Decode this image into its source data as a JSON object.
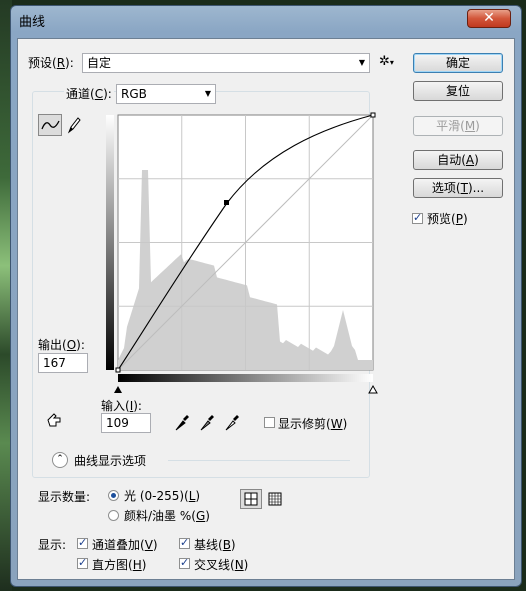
{
  "window": {
    "title": "曲线",
    "close": "✕"
  },
  "preset": {
    "label": "预设(",
    "key": "R",
    "tail": "):",
    "value": "自定"
  },
  "channel": {
    "label": "通道(",
    "key": "C",
    "tail": "):",
    "value": "RGB"
  },
  "buttons": {
    "ok": "确定",
    "reset": "复位",
    "smooth": {
      "pre": "平滑(",
      "key": "M",
      "post": ")"
    },
    "auto": {
      "pre": "自动(",
      "key": "A",
      "post": ")"
    },
    "options": {
      "pre": "选项(",
      "key": "T",
      "post": ")..."
    }
  },
  "preview": {
    "pre": "预览(",
    "key": "P",
    "post": ")",
    "checked": true
  },
  "output": {
    "pre": "输出(",
    "key": "O",
    "post": "):",
    "value": "167"
  },
  "input": {
    "pre": "输入(",
    "key": "I",
    "post": "):",
    "value": "109"
  },
  "show_clipping": {
    "pre": "显示修剪(",
    "key": "W",
    "post": ")",
    "checked": false
  },
  "curve_display_options": "曲线显示选项",
  "show_amount": {
    "label": "显示数量:",
    "light": {
      "pre": "光 (0-255)(",
      "key": "L",
      "post": ")",
      "selected": true
    },
    "pigment": {
      "pre": "颜料/油墨 %(",
      "key": "G",
      "post": ")",
      "selected": false
    }
  },
  "show": {
    "label": "显示:",
    "channel_overlays": {
      "pre": "通道叠加(",
      "key": "V",
      "post": ")",
      "checked": true
    },
    "baseline": {
      "pre": "基线(",
      "key": "B",
      "post": ")",
      "checked": true
    },
    "histogram": {
      "pre": "直方图(",
      "key": "H",
      "post": ")",
      "checked": true
    },
    "intersection_line": {
      "pre": "交叉线(",
      "key": "N",
      "post": ")",
      "checked": true
    }
  },
  "icons": [
    "gear-icon",
    "curve-tool-icon",
    "pencil-icon",
    "hand-adjust-icon",
    "black-eyedropper-icon",
    "gray-eyedropper-icon",
    "white-eyedropper-icon",
    "collapse-chevron-icon",
    "grid-4-icon",
    "grid-10-icon"
  ]
}
